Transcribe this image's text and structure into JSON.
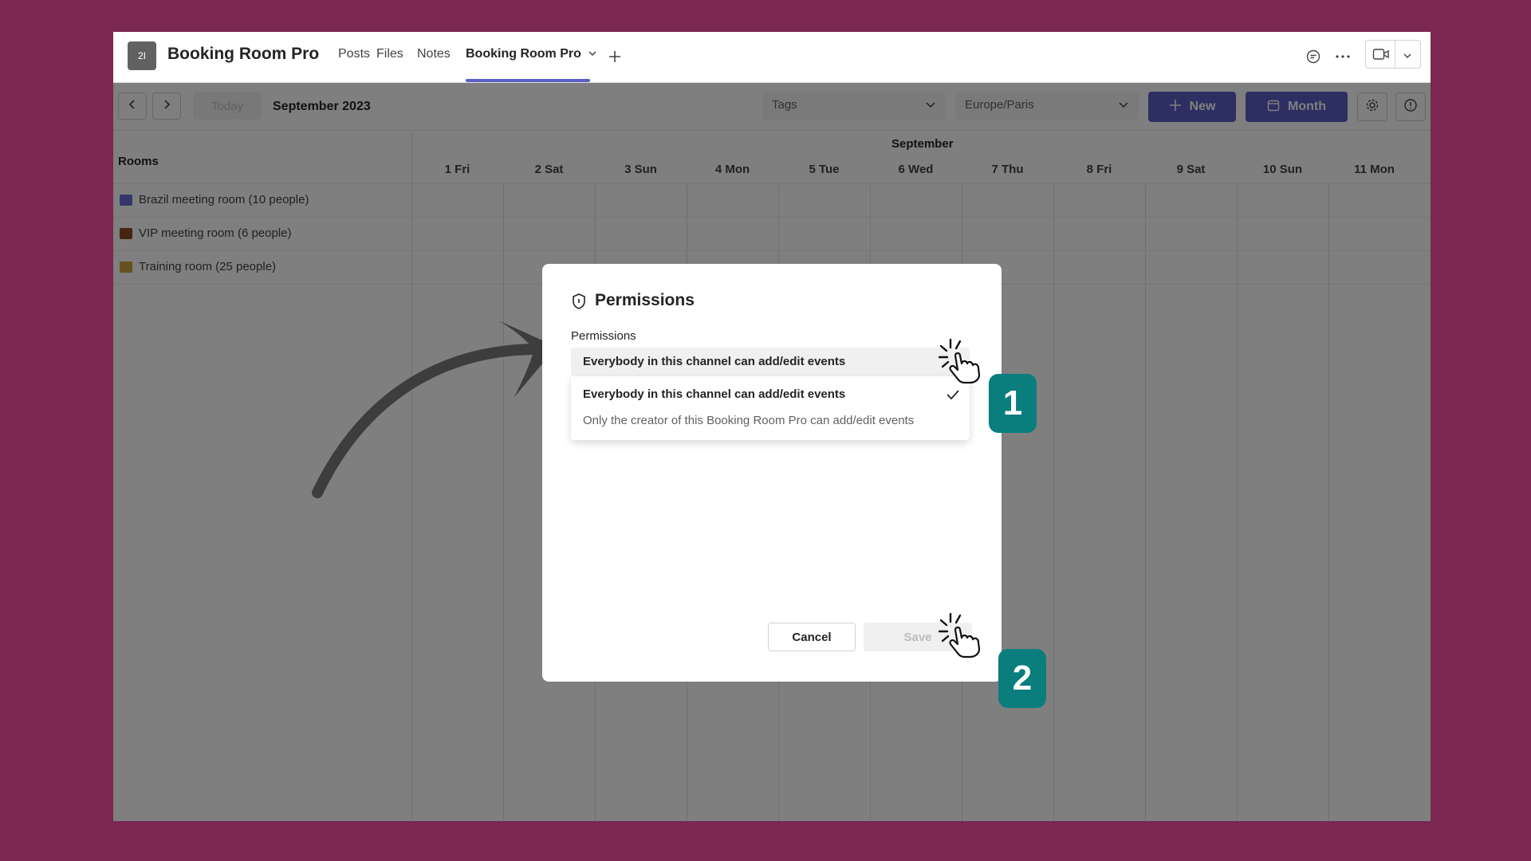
{
  "header": {
    "team_avatar": "2I",
    "team_name": "Booking Room Pro",
    "tabs": [
      {
        "label": "Posts"
      },
      {
        "label": "Files"
      },
      {
        "label": "Notes"
      },
      {
        "label": "Booking Room Pro"
      }
    ],
    "active_tab": "Booking Room Pro"
  },
  "toolbar": {
    "today_label": "Today",
    "period_label": "September 2023",
    "tags_placeholder": "Tags",
    "timezone": "Europe/Paris",
    "new_label": "New",
    "month_label": "Month"
  },
  "grid": {
    "rooms_title": "Rooms",
    "month_name": "September",
    "days": [
      "1 Fri",
      "2 Sat",
      "3 Sun",
      "4 Mon",
      "5 Tue",
      "6 Wed",
      "7 Thu",
      "8 Fri",
      "9 Sat",
      "10 Sun",
      "11 Mon"
    ],
    "rooms": [
      {
        "label": "Brazil meeting room (10 people)",
        "icon": "people-icon"
      },
      {
        "label": "VIP meeting room (6 people)",
        "icon": "briefcase-icon"
      },
      {
        "label": "Training room (25 people)",
        "icon": "classroom-icon"
      }
    ]
  },
  "dialog": {
    "title": "Permissions",
    "field_label": "Permissions",
    "selected_value": "Everybody in this channel can add/edit events",
    "options": [
      {
        "label": "Everybody in this channel can add/edit events",
        "selected": true
      },
      {
        "label": "Only the creator of this Booking Room Pro can add/edit events",
        "selected": false
      }
    ],
    "cancel_label": "Cancel",
    "save_label": "Save"
  },
  "annotations": {
    "step1": "1",
    "step2": "2"
  },
  "colors": {
    "background": "#7a2752",
    "accent": "#5b5fc7",
    "badge": "#0a7d7d"
  }
}
